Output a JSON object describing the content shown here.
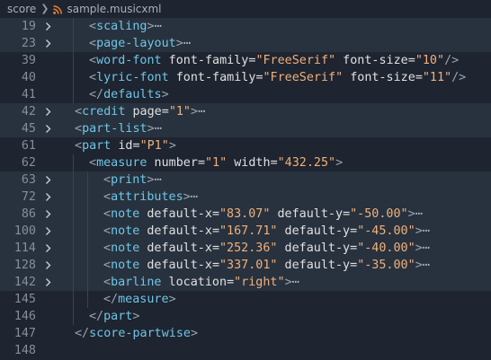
{
  "breadcrumb": {
    "folder": "score",
    "file": "sample.musicxml",
    "file_icon": "rss-icon"
  },
  "colors": {
    "background": "#1e2430",
    "fold_highlight": "#28323f",
    "tag": "#6ec6e6",
    "string": "#f0b07a",
    "line_number": "#858e99"
  },
  "lines": [
    {
      "num": "19",
      "fold": true,
      "indent": 1,
      "tokens": [
        {
          "t": "<",
          "c": "bracket"
        },
        {
          "t": "scaling",
          "c": "tag"
        },
        {
          "t": ">",
          "c": "bracket"
        },
        {
          "t": "⋯",
          "c": "fold"
        }
      ]
    },
    {
      "num": "23",
      "fold": true,
      "indent": 1,
      "tokens": [
        {
          "t": "<",
          "c": "bracket"
        },
        {
          "t": "page-layout",
          "c": "tag"
        },
        {
          "t": ">",
          "c": "bracket"
        },
        {
          "t": "⋯",
          "c": "fold"
        }
      ]
    },
    {
      "num": "39",
      "fold": false,
      "indent": 1,
      "tokens": [
        {
          "t": "<",
          "c": "bracket"
        },
        {
          "t": "word-font",
          "c": "tag"
        },
        {
          "t": " font-family",
          "c": "attr"
        },
        {
          "t": "=",
          "c": "eq"
        },
        {
          "t": "\"FreeSerif\"",
          "c": "str"
        },
        {
          "t": " font-size",
          "c": "attr"
        },
        {
          "t": "=",
          "c": "eq"
        },
        {
          "t": "\"10\"",
          "c": "str"
        },
        {
          "t": "/>",
          "c": "bracket"
        }
      ]
    },
    {
      "num": "40",
      "fold": false,
      "indent": 1,
      "tokens": [
        {
          "t": "<",
          "c": "bracket"
        },
        {
          "t": "lyric-font",
          "c": "tag"
        },
        {
          "t": " font-family",
          "c": "attr"
        },
        {
          "t": "=",
          "c": "eq"
        },
        {
          "t": "\"FreeSerif\"",
          "c": "str"
        },
        {
          "t": " font-size",
          "c": "attr"
        },
        {
          "t": "=",
          "c": "eq"
        },
        {
          "t": "\"11\"",
          "c": "str"
        },
        {
          "t": "/>",
          "c": "bracket"
        }
      ]
    },
    {
      "num": "41",
      "fold": false,
      "indent": 1,
      "tokens": [
        {
          "t": "</",
          "c": "bracket"
        },
        {
          "t": "defaults",
          "c": "tag"
        },
        {
          "t": ">",
          "c": "bracket"
        }
      ]
    },
    {
      "num": "42",
      "fold": true,
      "indent": 0,
      "tokens": [
        {
          "t": "<",
          "c": "bracket"
        },
        {
          "t": "credit",
          "c": "tag"
        },
        {
          "t": " page",
          "c": "attr"
        },
        {
          "t": "=",
          "c": "eq"
        },
        {
          "t": "\"1\"",
          "c": "str"
        },
        {
          "t": ">",
          "c": "bracket"
        },
        {
          "t": "⋯",
          "c": "fold"
        }
      ]
    },
    {
      "num": "45",
      "fold": true,
      "indent": 0,
      "tokens": [
        {
          "t": "<",
          "c": "bracket"
        },
        {
          "t": "part-list",
          "c": "tag"
        },
        {
          "t": ">",
          "c": "bracket"
        },
        {
          "t": "⋯",
          "c": "fold"
        }
      ]
    },
    {
      "num": "61",
      "fold": false,
      "indent": 0,
      "tokens": [
        {
          "t": "<",
          "c": "bracket"
        },
        {
          "t": "part",
          "c": "tag"
        },
        {
          "t": " id",
          "c": "attr"
        },
        {
          "t": "=",
          "c": "eq"
        },
        {
          "t": "\"P1\"",
          "c": "str"
        },
        {
          "t": ">",
          "c": "bracket"
        }
      ]
    },
    {
      "num": "62",
      "fold": false,
      "indent": 1,
      "tokens": [
        {
          "t": "<",
          "c": "bracket"
        },
        {
          "t": "measure",
          "c": "tag"
        },
        {
          "t": " number",
          "c": "attr"
        },
        {
          "t": "=",
          "c": "eq"
        },
        {
          "t": "\"1\"",
          "c": "str"
        },
        {
          "t": " width",
          "c": "attr"
        },
        {
          "t": "=",
          "c": "eq"
        },
        {
          "t": "\"432.25\"",
          "c": "str"
        },
        {
          "t": ">",
          "c": "bracket"
        }
      ]
    },
    {
      "num": "63",
      "fold": true,
      "indent": 2,
      "tokens": [
        {
          "t": "<",
          "c": "bracket"
        },
        {
          "t": "print",
          "c": "tag"
        },
        {
          "t": ">",
          "c": "bracket"
        },
        {
          "t": "⋯",
          "c": "fold"
        }
      ]
    },
    {
      "num": "72",
      "fold": true,
      "indent": 2,
      "tokens": [
        {
          "t": "<",
          "c": "bracket"
        },
        {
          "t": "attributes",
          "c": "tag"
        },
        {
          "t": ">",
          "c": "bracket"
        },
        {
          "t": "⋯",
          "c": "fold"
        }
      ]
    },
    {
      "num": "86",
      "fold": true,
      "indent": 2,
      "tokens": [
        {
          "t": "<",
          "c": "bracket"
        },
        {
          "t": "note",
          "c": "tag"
        },
        {
          "t": " default-x",
          "c": "attr"
        },
        {
          "t": "=",
          "c": "eq"
        },
        {
          "t": "\"83.07\"",
          "c": "str"
        },
        {
          "t": " default-y",
          "c": "attr"
        },
        {
          "t": "=",
          "c": "eq"
        },
        {
          "t": "\"-50.00\"",
          "c": "str"
        },
        {
          "t": ">",
          "c": "bracket"
        },
        {
          "t": "⋯",
          "c": "fold"
        }
      ]
    },
    {
      "num": "100",
      "fold": true,
      "indent": 2,
      "tokens": [
        {
          "t": "<",
          "c": "bracket"
        },
        {
          "t": "note",
          "c": "tag"
        },
        {
          "t": " default-x",
          "c": "attr"
        },
        {
          "t": "=",
          "c": "eq"
        },
        {
          "t": "\"167.71\"",
          "c": "str"
        },
        {
          "t": " default-y",
          "c": "attr"
        },
        {
          "t": "=",
          "c": "eq"
        },
        {
          "t": "\"-45.00\"",
          "c": "str"
        },
        {
          "t": ">",
          "c": "bracket"
        },
        {
          "t": "⋯",
          "c": "fold"
        }
      ]
    },
    {
      "num": "114",
      "fold": true,
      "indent": 2,
      "tokens": [
        {
          "t": "<",
          "c": "bracket"
        },
        {
          "t": "note",
          "c": "tag"
        },
        {
          "t": " default-x",
          "c": "attr"
        },
        {
          "t": "=",
          "c": "eq"
        },
        {
          "t": "\"252.36\"",
          "c": "str"
        },
        {
          "t": " default-y",
          "c": "attr"
        },
        {
          "t": "=",
          "c": "eq"
        },
        {
          "t": "\"-40.00\"",
          "c": "str"
        },
        {
          "t": ">",
          "c": "bracket"
        },
        {
          "t": "⋯",
          "c": "fold"
        }
      ]
    },
    {
      "num": "128",
      "fold": true,
      "indent": 2,
      "tokens": [
        {
          "t": "<",
          "c": "bracket"
        },
        {
          "t": "note",
          "c": "tag"
        },
        {
          "t": " default-x",
          "c": "attr"
        },
        {
          "t": "=",
          "c": "eq"
        },
        {
          "t": "\"337.01\"",
          "c": "str"
        },
        {
          "t": " default-y",
          "c": "attr"
        },
        {
          "t": "=",
          "c": "eq"
        },
        {
          "t": "\"-35.00\"",
          "c": "str"
        },
        {
          "t": ">",
          "c": "bracket"
        },
        {
          "t": "⋯",
          "c": "fold"
        }
      ]
    },
    {
      "num": "142",
      "fold": true,
      "indent": 2,
      "tokens": [
        {
          "t": "<",
          "c": "bracket"
        },
        {
          "t": "barline",
          "c": "tag"
        },
        {
          "t": " location",
          "c": "attr"
        },
        {
          "t": "=",
          "c": "eq"
        },
        {
          "t": "\"right\"",
          "c": "str"
        },
        {
          "t": ">",
          "c": "bracket"
        },
        {
          "t": "⋯",
          "c": "fold"
        }
      ]
    },
    {
      "num": "145",
      "fold": false,
      "indent": 2,
      "tokens": [
        {
          "t": "</",
          "c": "bracket"
        },
        {
          "t": "measure",
          "c": "tag"
        },
        {
          "t": ">",
          "c": "bracket"
        }
      ]
    },
    {
      "num": "146",
      "fold": false,
      "indent": 1,
      "tokens": [
        {
          "t": "</",
          "c": "bracket"
        },
        {
          "t": "part",
          "c": "tag"
        },
        {
          "t": ">",
          "c": "bracket"
        }
      ]
    },
    {
      "num": "147",
      "fold": false,
      "indent": 0,
      "tokens": [
        {
          "t": "</",
          "c": "bracket"
        },
        {
          "t": "score-partwise",
          "c": "tag"
        },
        {
          "t": ">",
          "c": "bracket"
        }
      ]
    },
    {
      "num": "148",
      "fold": false,
      "indent": 0,
      "tokens": []
    }
  ]
}
